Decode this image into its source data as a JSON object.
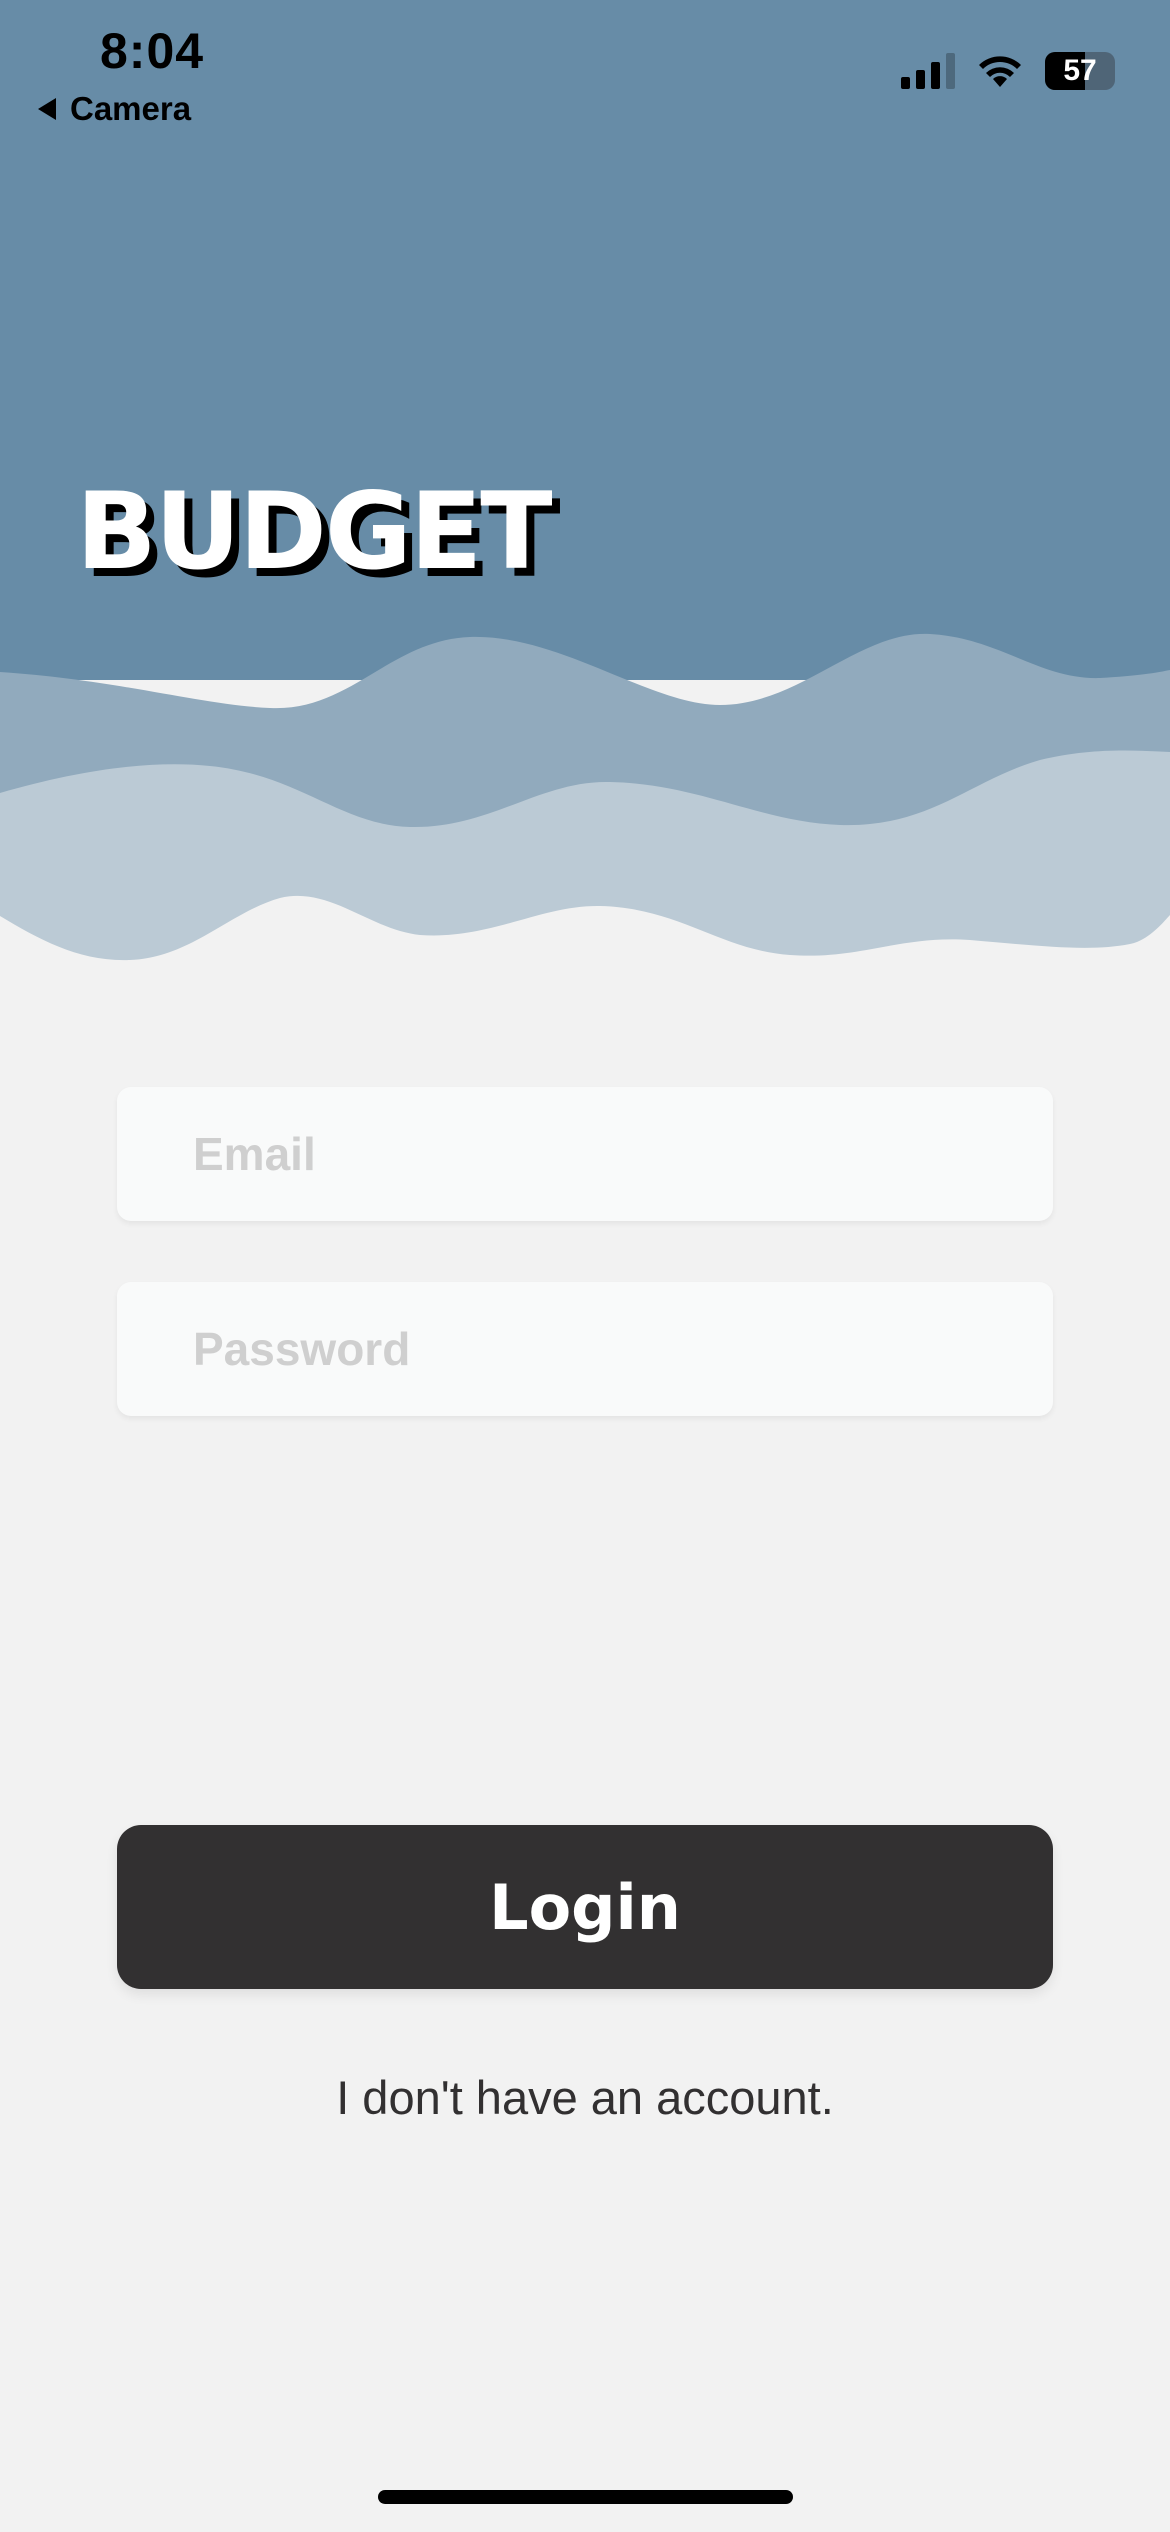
{
  "status_bar": {
    "time": "8:04",
    "back_label": "Camera",
    "battery_level": "57",
    "battery_fraction": 0.57,
    "signal_bars": 3,
    "signal_bars_total": 4,
    "icons": [
      "signal-icon",
      "wifi-icon",
      "battery-icon"
    ]
  },
  "hero": {
    "title": "BUDGET",
    "colors": {
      "sky": "#678ca7",
      "wave_mid": "#91aabd",
      "wave_light": "#bbcad5",
      "background": "#f2f2f2"
    }
  },
  "form": {
    "email_placeholder": "Email",
    "email_value": "",
    "password_placeholder": "Password",
    "password_value": ""
  },
  "actions": {
    "login_label": "Login",
    "signup_link": "I don't have an account."
  },
  "colors": {
    "button": "#323031",
    "field_bg": "#f9fafa",
    "placeholder": "#cfcfcf"
  }
}
